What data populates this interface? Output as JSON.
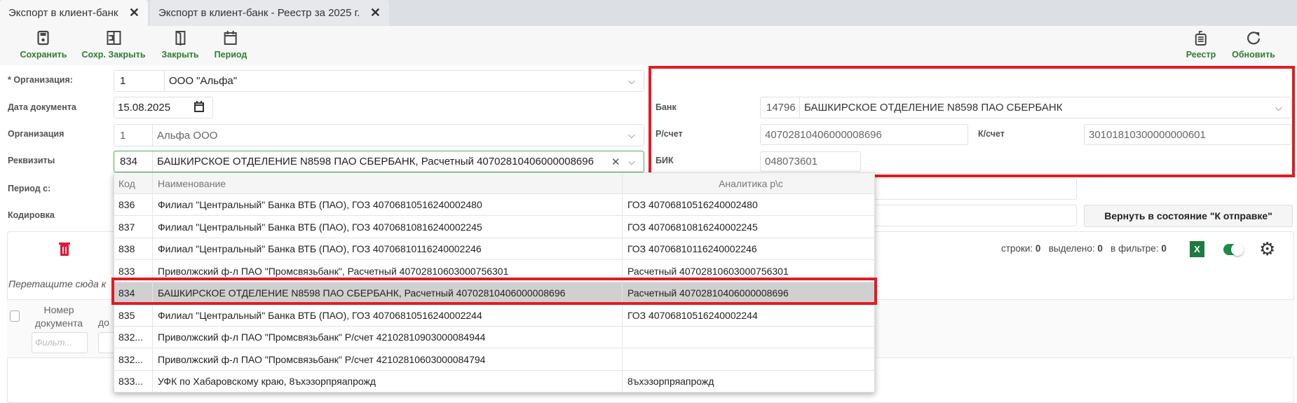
{
  "tabs": [
    {
      "label": "Экспорт в клиент-банк",
      "active": true
    },
    {
      "label": "Экспорт в клиент-банк - Реестр за 2025 г.",
      "active": false
    }
  ],
  "toolbar": {
    "save": "Сохранить",
    "save_close": "Сохр. Закрыть",
    "close": "Закрыть",
    "period": "Период",
    "registry": "Реестр",
    "refresh": "Обновить"
  },
  "form": {
    "org_label": "* Организация:",
    "org_code": "1",
    "org_name": "ООО \"Альфа\"",
    "date_label": "Дата документа",
    "date": "15.08.2025",
    "org2_label": "Организация",
    "org2_code": "1",
    "org2_name": "Альфа ООО",
    "req_label": "Реквизиты",
    "req_code": "834",
    "req_value": "БАШКИРСКОЕ ОТДЕЛЕНИЕ N8598 ПАО СБЕРБАНК, Расчетный 40702810406000008696",
    "period_label": "Период с:",
    "encoding_label": "Кодировка",
    "revert_button": "Вернуть в состояние \"К отправке\""
  },
  "bank": {
    "bank_label": "Банк",
    "bank_code": "14796",
    "bank_name": "БАШКИРСКОЕ ОТДЕЛЕНИЕ N8598 ПАО СБЕРБАНК",
    "rs_label": "Р/счет",
    "rs": "40702810406000008696",
    "ks_label": "К/счет",
    "ks": "30101810300000000601",
    "bik_label": "БИК",
    "bik": "048073601"
  },
  "grid": {
    "rows_label": "строки:",
    "rows": "0",
    "selected_label": "выделено:",
    "selected": "0",
    "filter_label": "в фильтре:",
    "filter": "0",
    "excel": "X",
    "drag_hint": "Перетащите сюда к",
    "col_number": "Номер документа",
    "col_2": "до",
    "filter_placeholder": "Фильт..."
  },
  "dropdown": {
    "headers": [
      "Код",
      "Наименование",
      "Аналитика р\\с"
    ],
    "rows": [
      [
        "836",
        "Филиал \"Центральный\" Банка ВТБ (ПАО), ГОЗ 40706810516240002480",
        "ГОЗ 40706810516240002480"
      ],
      [
        "837",
        "Филиал \"Центральный\" Банка ВТБ (ПАО), ГОЗ 40706810816240002245",
        "ГОЗ 40706810816240002245"
      ],
      [
        "838",
        "Филиал \"Центральный\" Банка ВТБ (ПАО), ГОЗ 40706810116240002246",
        "ГОЗ 40706810116240002246"
      ],
      [
        "833",
        "Приволжский ф-л ПАО \"Промсвязьбанк\", Расчетный 40702810603000756301",
        "Расчетный 40702810603000756301"
      ],
      [
        "834",
        "БАШКИРСКОЕ ОТДЕЛЕНИЕ N8598 ПАО СБЕРБАНК, Расчетный 40702810406000008696",
        "Расчетный 40702810406000008696"
      ],
      [
        "835",
        "Филиал \"Центральный\" Банка ВТБ (ПАО), ГОЗ 40706810516240002244",
        "ГОЗ 40706810516240002244"
      ],
      [
        "832...",
        "Приволжский ф-л ПАО \"Промсвязьбанк\" Р/счет 42102810903000084944",
        ""
      ],
      [
        "832...",
        "Приволжский ф-л ПАО \"Промсвязьбанк\" Р/счет 42102810603000084794",
        ""
      ],
      [
        "833...",
        "УФК по Хабаровскому краю, 8ъхэзорпряапрожд",
        "8ъхэзорпряапрожд"
      ]
    ],
    "selected_index": 4
  },
  "colors": {
    "accent": "#2e7d32",
    "highlight": "#e21b23",
    "selected_row": "#d0d0d0"
  }
}
